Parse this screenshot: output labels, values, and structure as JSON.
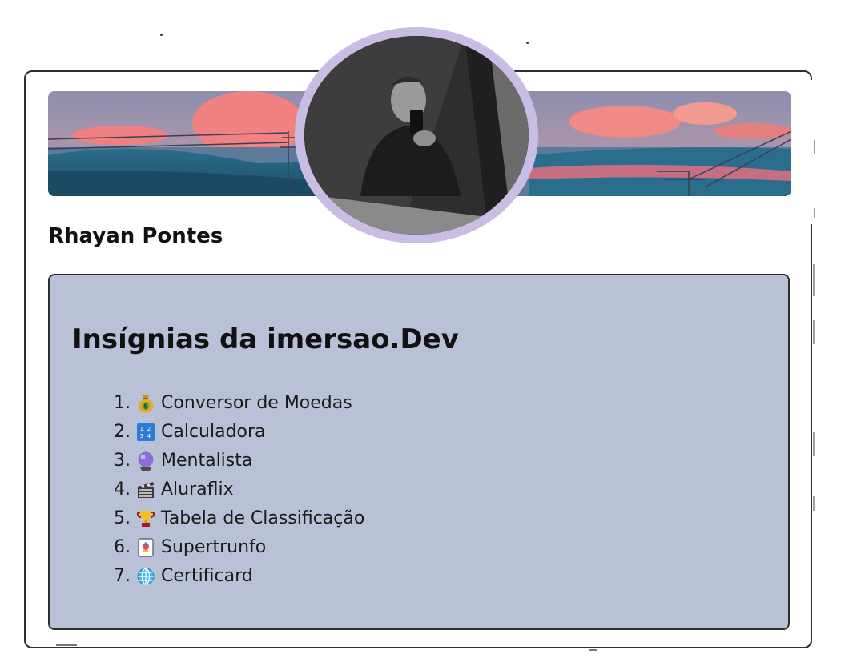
{
  "profile": {
    "name": "Rhayan Pontes"
  },
  "badges": {
    "title": "Insígnias da imersao.Dev",
    "items": [
      {
        "number": "1.",
        "label": "Conversor de Moedas",
        "icon": "money-bag-icon"
      },
      {
        "number": "2.",
        "label": "Calculadora",
        "icon": "numbers-keypad-icon"
      },
      {
        "number": "3.",
        "label": "Mentalista",
        "icon": "crystal-ball-icon"
      },
      {
        "number": "4.",
        "label": "Aluraflix",
        "icon": "clapper-board-icon"
      },
      {
        "number": "5.",
        "label": "Tabela de Classificação",
        "icon": "trophy-icon"
      },
      {
        "number": "6.",
        "label": "Supertrunfo",
        "icon": "joker-card-icon"
      },
      {
        "number": "7.",
        "label": "Certificard",
        "icon": "globe-icon"
      }
    ]
  },
  "colors": {
    "panel_background": "#b8c1d6",
    "avatar_ring": "#c9bde3",
    "card_border": "#2e2e2e"
  }
}
